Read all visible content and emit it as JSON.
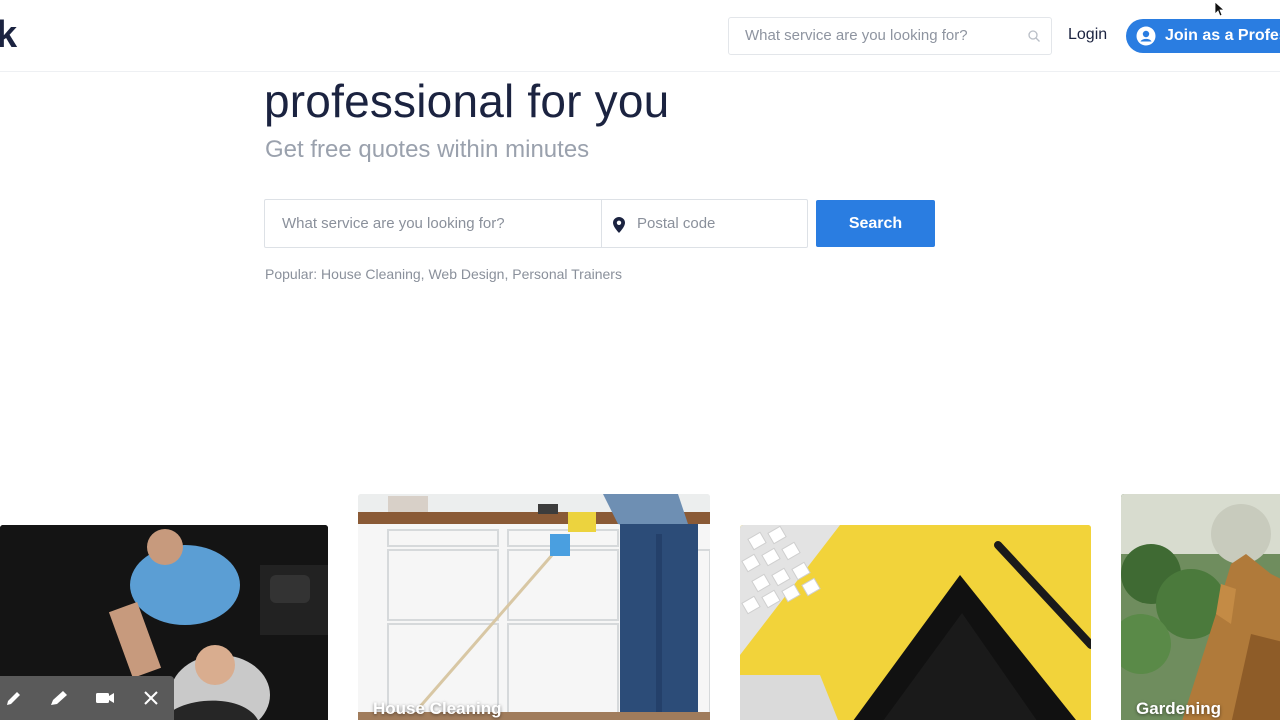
{
  "header": {
    "logo_text": "k",
    "search_placeholder": "What service are you looking for?",
    "login_label": "Login",
    "join_label": "Join as a Professional"
  },
  "hero": {
    "title": "professional for you",
    "subtitle": "Get free quotes within minutes"
  },
  "search": {
    "service_placeholder": "What service are you looking for?",
    "postal_placeholder": "Postal code",
    "button_label": "Search"
  },
  "popular": {
    "prefix": "Popular:",
    "items": [
      "House Cleaning",
      "Web Design",
      "Personal Trainers"
    ]
  },
  "cards": [
    {
      "label": ""
    },
    {
      "label": "House Cleaning"
    },
    {
      "label": ""
    },
    {
      "label": "Gardening"
    }
  ],
  "colors": {
    "accent": "#2a7de1",
    "heading": "#1b2340",
    "muted": "#9aa1ad"
  },
  "toolbar": {
    "icons": [
      "pencil-icon",
      "highlighter-icon",
      "camera-icon",
      "close-icon"
    ]
  }
}
